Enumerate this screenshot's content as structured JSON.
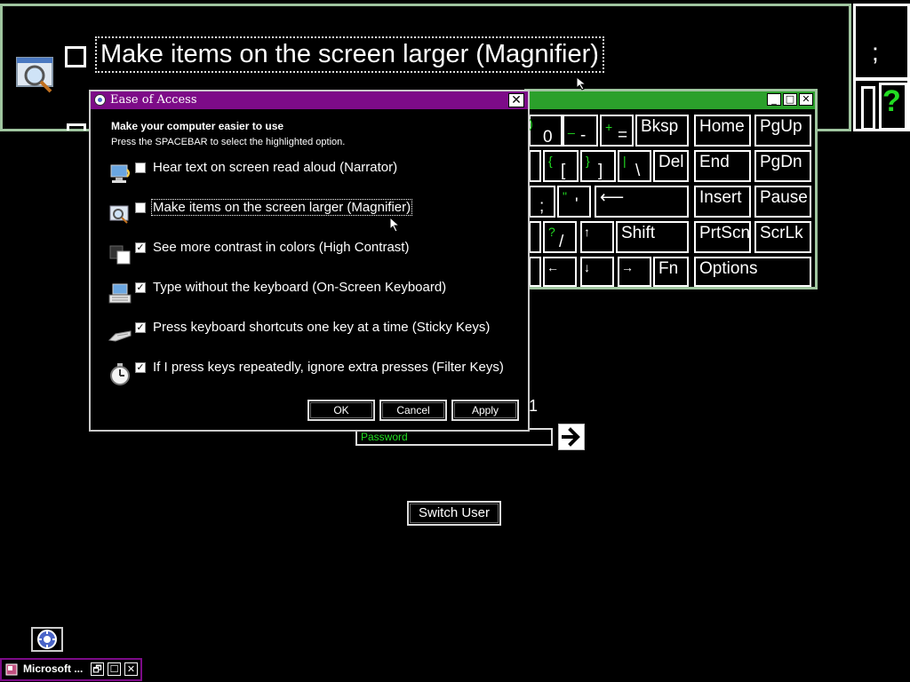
{
  "magnifier_view": {
    "option_label": "Make items on the screen larger (Magnifier)",
    "side_key_top": ";",
    "side_key_bottom": "?"
  },
  "osk": {
    "title_buttons": [
      "_",
      "□",
      "✕"
    ],
    "keys": {
      "zero": "0",
      "minus_top": "_",
      "minus_bottom": "-",
      "plus_top": "+",
      "plus_bottom": "=",
      "bksp": "Bksp",
      "home": "Home",
      "pgup": "PgUp",
      "brace_left_top": "{",
      "brace_left_bottom": "[",
      "brace_right_top": "}",
      "brace_right_bottom": "]",
      "pipe_top": "|",
      "pipe_bottom": "\\",
      "del": "Del",
      "end": "End",
      "pgdn": "PgDn",
      "semicolon": ";",
      "quote_top": "\"",
      "quote_bottom": "'",
      "enter": "⟵",
      "insert": "Insert",
      "pause": "Pause",
      "question_top": "?",
      "question_bottom": "/",
      "up": "↑",
      "shift": "Shift",
      "prtscn": "PrtScn",
      "scrlk": "ScrLk",
      "left": "←",
      "down": "↓",
      "right": "→",
      "fn": "Fn",
      "options": "Options"
    }
  },
  "dialog": {
    "title": "Ease of Access",
    "close_glyph": "✕",
    "heading": "Make your computer easier to use",
    "instruction": "Press the SPACEBAR to select the highlighted option.",
    "options": [
      {
        "label": "Hear text on screen read aloud (Narrator)",
        "checked": false,
        "icon": "narrator-icon"
      },
      {
        "label": "Make items on the screen larger (Magnifier)",
        "checked": false,
        "icon": "magnifier-icon"
      },
      {
        "label": "See more contrast in colors (High Contrast)",
        "checked": true,
        "icon": "high-contrast-icon"
      },
      {
        "label": "Type without the keyboard (On-Screen Keyboard)",
        "checked": true,
        "icon": "keyboard-icon"
      },
      {
        "label": "Press keyboard shortcuts one key at a time (Sticky Keys)",
        "checked": true,
        "icon": "sticky-keys-icon"
      },
      {
        "label": "If I press keys repeatedly, ignore extra presses (Filter Keys)",
        "checked": true,
        "icon": "stopwatch-icon"
      }
    ],
    "buttons": {
      "ok": "OK",
      "cancel": "Cancel",
      "apply": "Apply"
    }
  },
  "logon": {
    "user_fragment": "1",
    "password_placeholder": "Password",
    "switch_user": "Switch User"
  },
  "taskbar": {
    "item_label": "Microsoft ...",
    "item_buttons": [
      "🗗",
      "☐",
      "✕"
    ]
  },
  "colors": {
    "dialog_title_bar": "#7d0b88",
    "osk_title_bar": "#2ba02b",
    "accent_green": "#22dd22"
  }
}
